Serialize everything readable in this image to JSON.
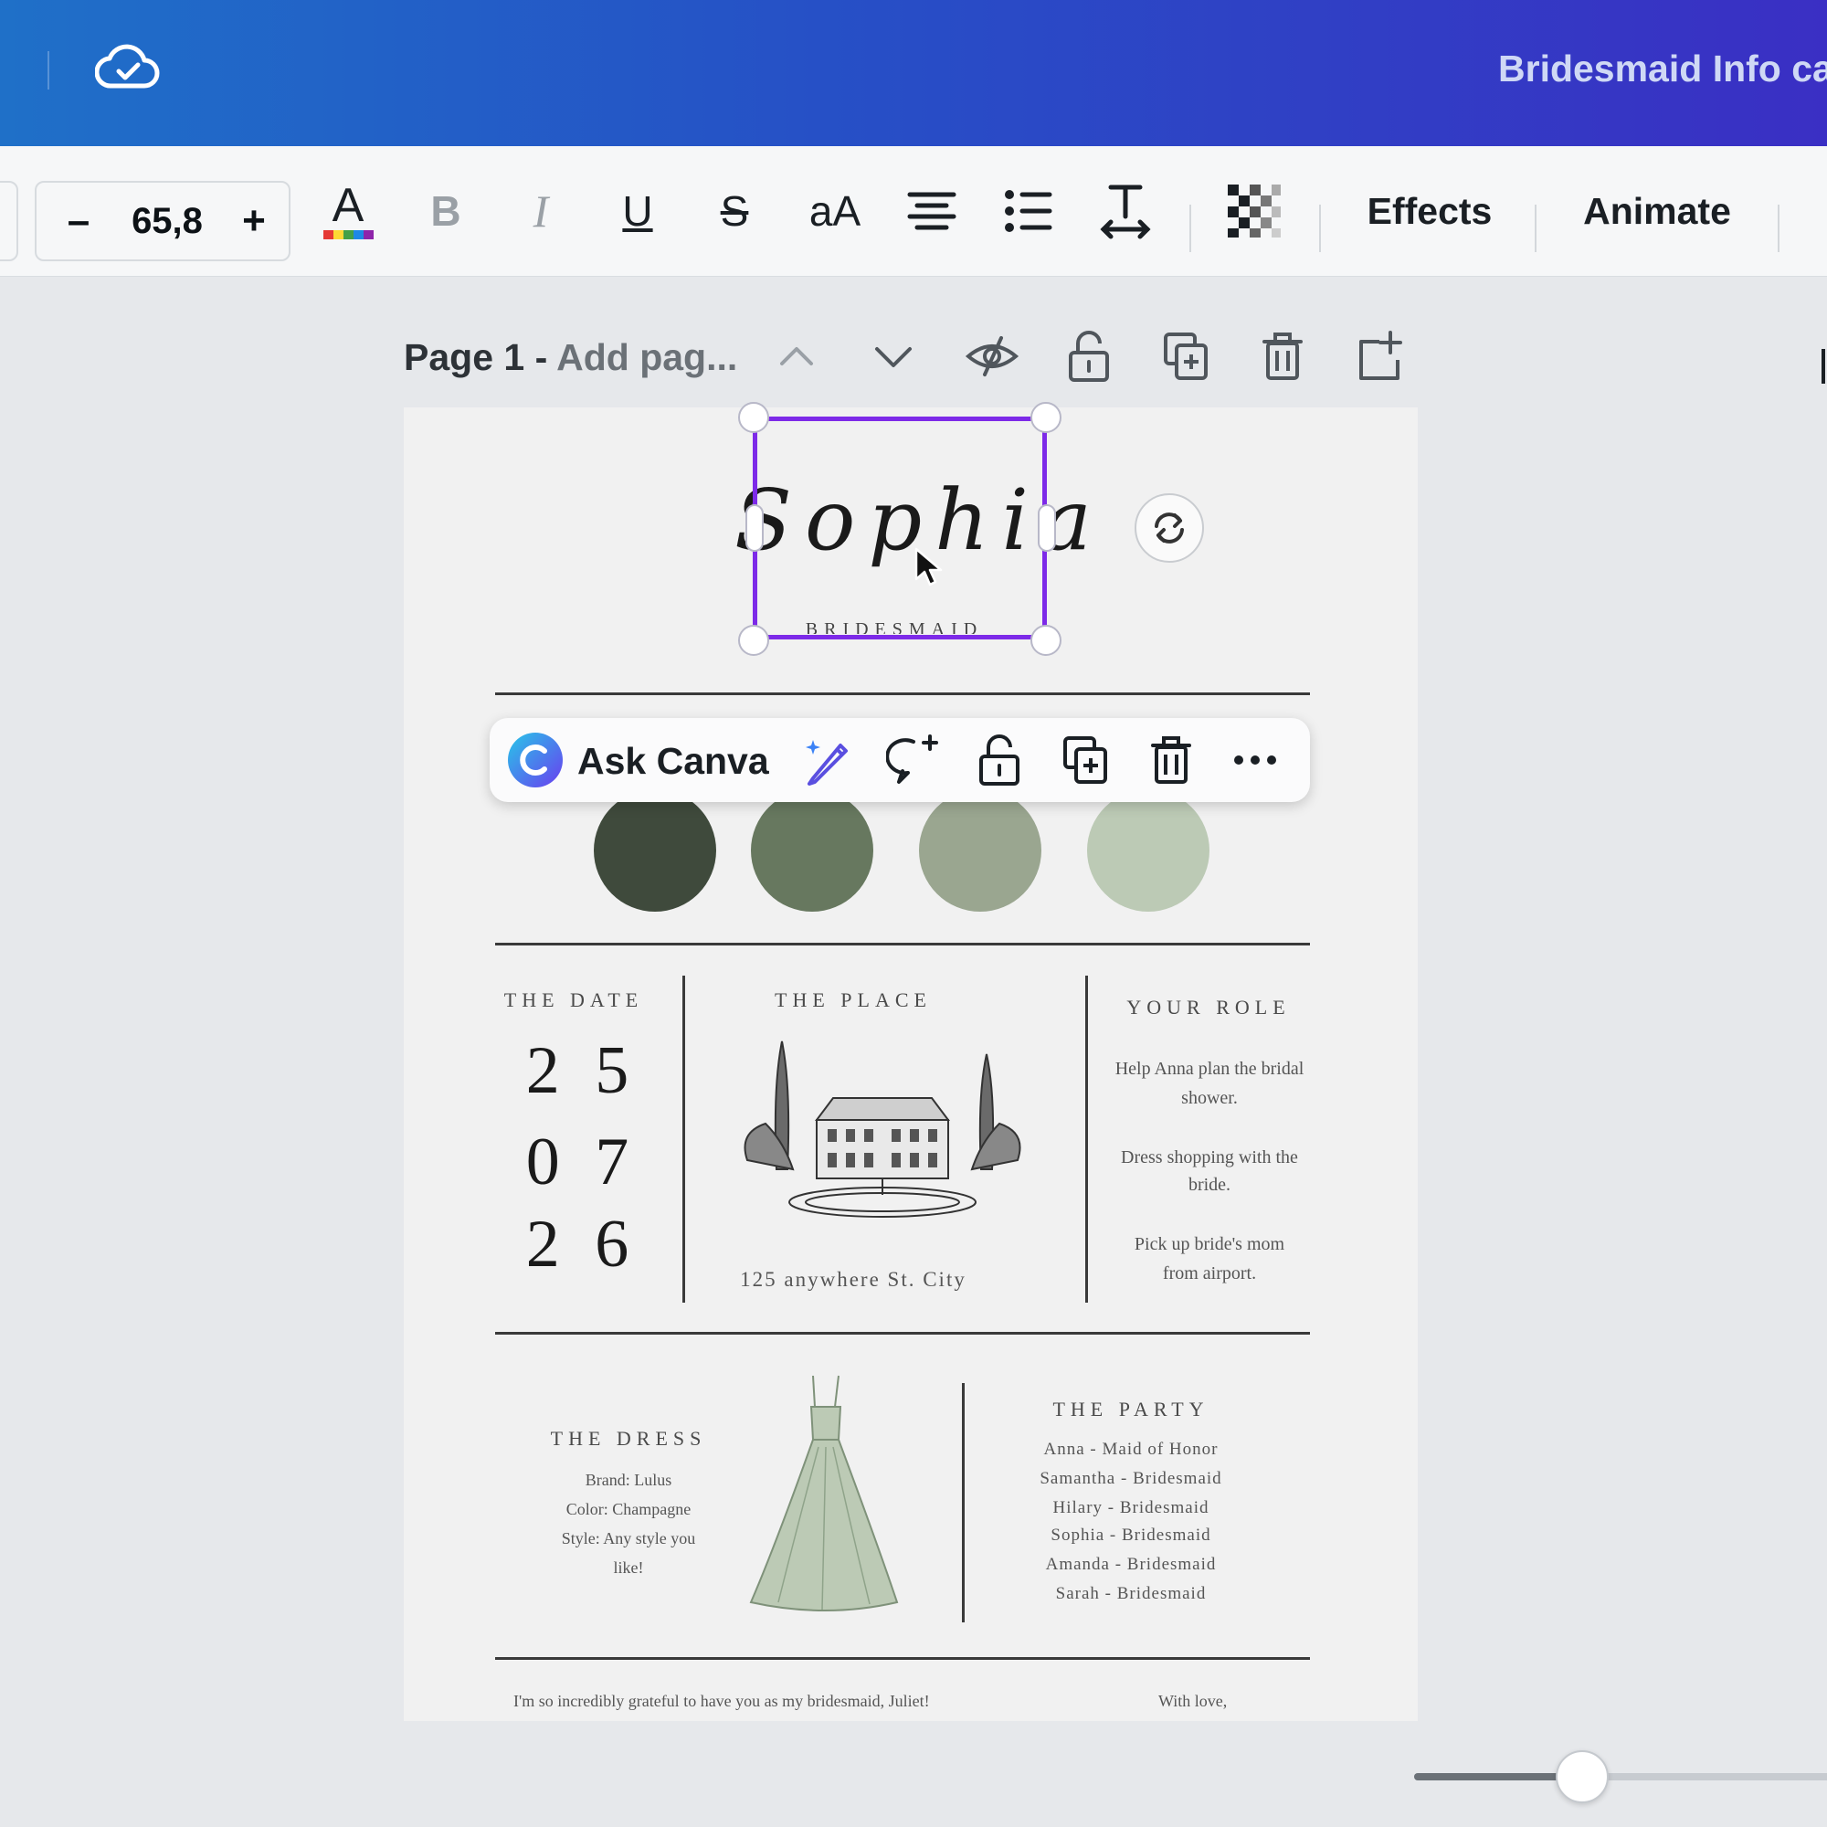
{
  "header": {
    "doc_title": "Bridesmaid Info ca",
    "cloud_icon": "cloud-check-icon"
  },
  "toolbar": {
    "font_size": "65,8",
    "minus_label": "–",
    "plus_label": "+",
    "bold_label": "B",
    "italic_label": "I",
    "underline_label": "U",
    "strike_label": "S",
    "case_label": "aA",
    "effects_label": "Effects",
    "animate_label": "Animate",
    "colors": {
      "text_color_bar": [
        "#e53935",
        "#fdd835",
        "#43a047",
        "#1e88e5",
        "#8e24aa"
      ]
    }
  },
  "page_header": {
    "page_number": "Page 1 - ",
    "page_title_placeholder": "Add pag..."
  },
  "design": {
    "name_script": "Sophia",
    "name_subtitle": "BRIDESMAID",
    "palette": [
      "#3f4a3c",
      "#67785f",
      "#9aa690",
      "#bccab5"
    ],
    "date": {
      "heading": "THE DATE",
      "lines": [
        "2 5",
        "0 7",
        "2 6"
      ]
    },
    "place": {
      "heading": "THE PLACE",
      "address": "125 anywhere St. City"
    },
    "role": {
      "heading": "YOUR ROLE",
      "items": [
        "Help Anna plan the bridal shower.",
        "Dress shopping with the bride.",
        "Pick up bride's mom from airport."
      ]
    },
    "dress": {
      "heading": "THE DRESS",
      "details": [
        "Brand: Lulus",
        "Color: Champagne",
        "Style: Any style you",
        "like!"
      ]
    },
    "party": {
      "heading": "THE PARTY",
      "members": [
        "Anna - Maid of Honor",
        "Samantha - Bridesmaid",
        "Hilary - Bridesmaid",
        "Sophia - Bridesmaid",
        "Amanda - Bridesmaid",
        "Sarah - Bridesmaid"
      ]
    },
    "footer_note": "I'm so incredibly grateful to have you as my bridesmaid, Juliet!",
    "footer_sign": "With love,"
  },
  "float_menu": {
    "ask_label": "Ask Canva"
  },
  "zoom": {
    "level_fraction": 0.4
  }
}
